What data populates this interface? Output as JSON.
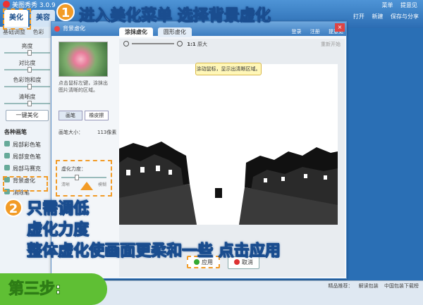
{
  "app": {
    "title": "美图秀秀 3.0.9",
    "tabs": [
      "美化",
      "美容"
    ],
    "right_menu": [
      "菜单",
      "提意见"
    ],
    "actions": [
      "打开",
      "新建",
      "保存与分享"
    ]
  },
  "left_panel": {
    "sub_tabs": [
      "基础调整",
      "色彩"
    ],
    "sliders": [
      "亮度",
      "对比度",
      "色彩饱和度",
      "清晰度"
    ],
    "one_key": "一键美化",
    "brush_section_title": "各种画笔",
    "brushes": [
      "局部彩色笔",
      "局部变色笔",
      "局部马赛克",
      "背景虚化",
      "消除笔"
    ]
  },
  "dialog": {
    "title": "背景虚化",
    "tabs": [
      "涂抹虚化",
      "圆形虚化"
    ],
    "right_menu": [
      "登录",
      "注册",
      "提意见"
    ],
    "toolbar": {
      "ratio": "1:1",
      "original": "原大",
      "undo": "重新开始"
    },
    "hint": "点击鼠标左键，涂抹出图片清晰的区域。",
    "modes": [
      "画笔",
      "橡皮擦"
    ],
    "brush_size_label": "画笔大小：",
    "brush_size_value": "113像素",
    "strength_label": "虚化力度：",
    "strength_min": "清晰",
    "strength_max": "模糊",
    "tooltip": "涂动鼠标，显示出清晰区域。",
    "apply": "应用",
    "cancel": "取消"
  },
  "status": {
    "items": [
      "精品推荐：",
      "解读包装",
      "中国包装下载榜"
    ]
  },
  "overlay": {
    "step1_num": "1",
    "step1_text": "进入美化菜单 选择背景虚化",
    "step2_num": "2",
    "step2_line1": "只需调低",
    "step2_line2": "虚化力度",
    "step2_line3": "整体虚化使画面更柔和一些 点击应用",
    "step_badge": "第三步:"
  },
  "colors": {
    "accent": "#f29b26",
    "brand": "#2a6fb5",
    "badge": "#5fbf34"
  }
}
